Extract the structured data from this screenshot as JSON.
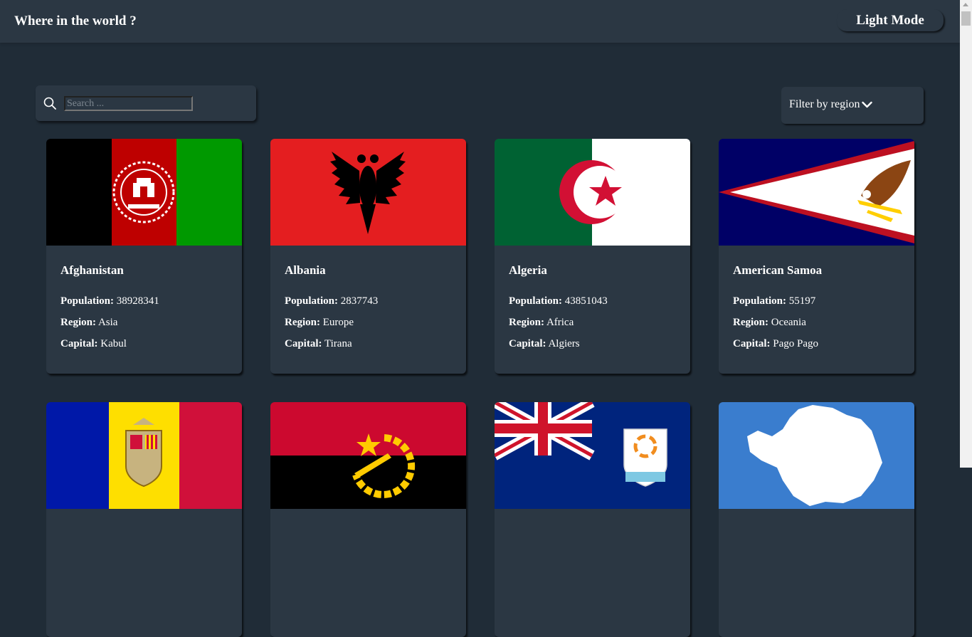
{
  "header": {
    "title": "Where in the world ?",
    "mode_button_label": "Light Mode"
  },
  "search": {
    "placeholder": "Search ...",
    "value": "",
    "icon": "search-icon"
  },
  "filter": {
    "label": "Filter by region",
    "icon": "chevron-down-icon"
  },
  "field_labels": {
    "population": "Population:",
    "region": "Region:",
    "capital": "Capital:"
  },
  "countries": [
    {
      "name": "Afghanistan",
      "population": "38928341",
      "region": "Asia",
      "capital": "Kabul"
    },
    {
      "name": "Albania",
      "population": "2837743",
      "region": "Europe",
      "capital": "Tirana"
    },
    {
      "name": "Algeria",
      "population": "43851043",
      "region": "Africa",
      "capital": "Algiers"
    },
    {
      "name": "American Samoa",
      "population": "55197",
      "region": "Oceania",
      "capital": "Pago Pago"
    }
  ],
  "partial_countries": [
    {
      "flag": "andorra-flag"
    },
    {
      "flag": "angola-flag"
    },
    {
      "flag": "anguilla-flag"
    },
    {
      "flag": "antarctica-flag"
    }
  ],
  "colors": {
    "background": "#202c37",
    "element": "#2b3743",
    "text": "#ffffff"
  }
}
